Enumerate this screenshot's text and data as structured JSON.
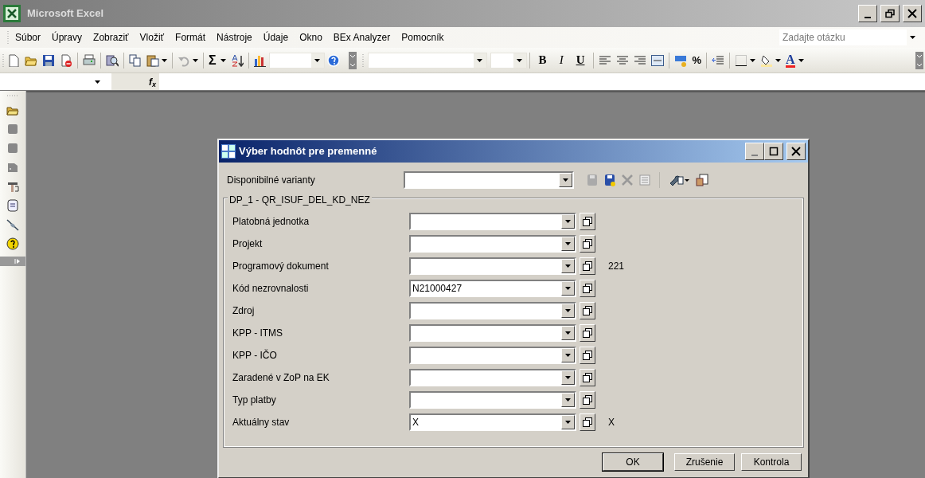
{
  "app_window": {
    "title": "Microsoft Excel"
  },
  "menu": [
    {
      "label": "Súbor"
    },
    {
      "label": "Úpravy"
    },
    {
      "label": "Zobraziť"
    },
    {
      "label": "Vložiť"
    },
    {
      "label": "Formát"
    },
    {
      "label": "Nástroje"
    },
    {
      "label": "Údaje"
    },
    {
      "label": "Okno"
    },
    {
      "label": "BEx Analyzer"
    },
    {
      "label": "Pomocník"
    }
  ],
  "help_search": {
    "placeholder": "Zadajte otázku"
  },
  "toolbar": {
    "sum_label": "Σ",
    "format_buttons": [
      "B",
      "I",
      "U"
    ],
    "percent_label": "%",
    "font_color_label": "A"
  },
  "formula_bar": {
    "fx_label": "f$_{x}$"
  },
  "dialog": {
    "title": "Výber hodnôt pre premenné",
    "variants_label": "Disponibilné varianty",
    "group_title": "DP_1 - QR_ISUF_DEL_KD_NEZ",
    "fields": [
      {
        "label": "Platobná jednotka"
      },
      {
        "label": "Projekt"
      },
      {
        "label": "Programový dokument",
        "note": "221"
      },
      {
        "label": "Kód nezrovnalosti",
        "value": "N21000427"
      },
      {
        "label": "Zdroj"
      },
      {
        "label": "KPP - ITMS"
      },
      {
        "label": "KPP - IČO"
      },
      {
        "label": "Zaradené v ZoP na EK"
      },
      {
        "label": "Typ platby"
      },
      {
        "label": "Aktuálny stav",
        "value": "X",
        "note": "X"
      }
    ],
    "buttons": [
      "OK",
      "Zrušenie",
      "Kontrola"
    ]
  }
}
